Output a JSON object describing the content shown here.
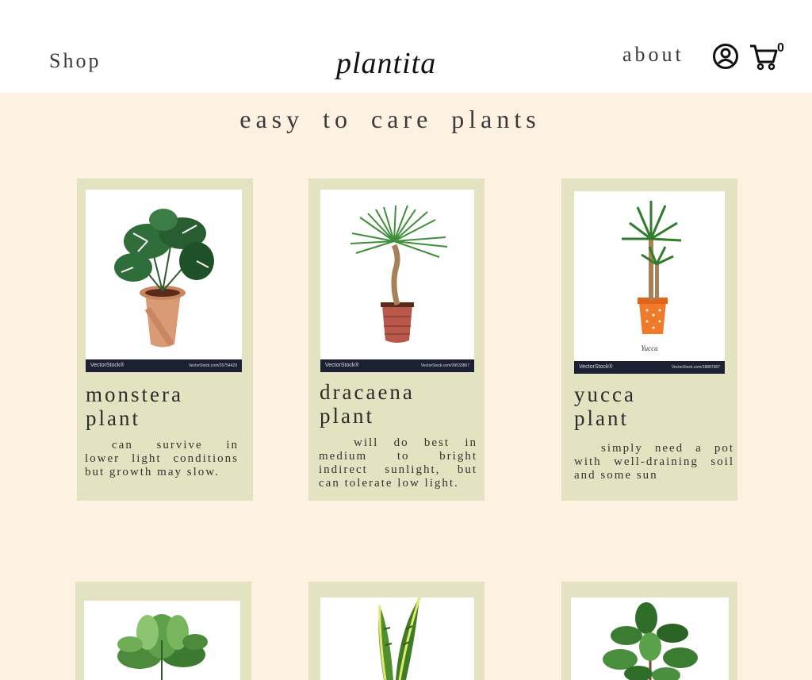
{
  "header": {
    "shop_label": "Shop",
    "brand": "plantita",
    "about_label": "about",
    "account_icon": "user-circle-icon",
    "cart_icon": "shopping-cart-icon",
    "cart_count": "0"
  },
  "section_title": "easy to care plants",
  "colors": {
    "background": "#fdf1e1",
    "card": "#e3e3c1",
    "header": "#ffffff"
  },
  "products": [
    {
      "name": "monstera\nplant",
      "description": "can survive in lower light conditions but growth may slow.",
      "image_footer_left": "VectorStock®",
      "image_footer_right": "VectorStock.com/25754429"
    },
    {
      "name": "dracaena\nplant",
      "description": "will do best in medium to bright indirect sunlight, but can tolerate low light.",
      "image_footer_left": "VectorStock®",
      "image_footer_right": "VectorStock.com/39533867"
    },
    {
      "name": "yucca\nplant",
      "description": "simply need a pot with well-draining soil and some sun",
      "image_footer_left": "VectorStock®",
      "image_footer_right": "VectorStock.com/18887987",
      "image_caption": "Yucca"
    },
    {
      "name": "",
      "description": ""
    },
    {
      "name": "",
      "description": ""
    },
    {
      "name": "",
      "description": ""
    }
  ]
}
